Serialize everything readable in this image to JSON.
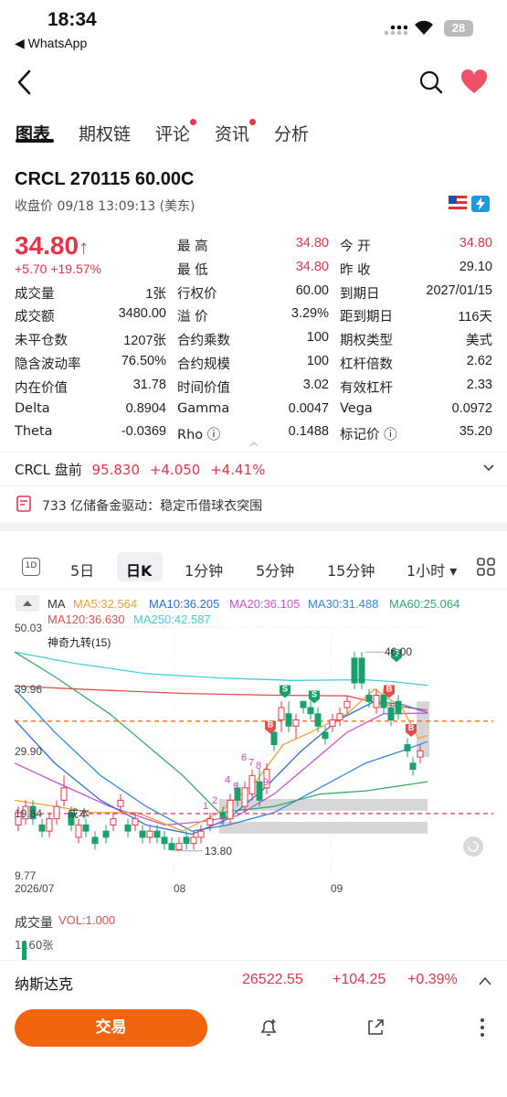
{
  "status_bar": {
    "time": "18:34",
    "back_app": "◀ WhatsApp",
    "battery": "28"
  },
  "tabs": [
    {
      "label": "图表",
      "active": true,
      "dot": false
    },
    {
      "label": "期权链",
      "active": false,
      "dot": false
    },
    {
      "label": "评论",
      "active": false,
      "dot": true
    },
    {
      "label": "资讯",
      "active": false,
      "dot": true
    },
    {
      "label": "分析",
      "active": false,
      "dot": false
    }
  ],
  "header": {
    "symbol": "CRCL 270115 60.00C",
    "close_info": "收盘价 09/18 13:09:13 (美东)",
    "price": "34.80",
    "price_arrow": "↑",
    "change": "+5.70  +19.57%"
  },
  "quote": {
    "rows": [
      [
        {
          "l": "最 高",
          "v": "34.80",
          "red": true
        },
        {
          "l": "今 开",
          "v": "34.80",
          "red": true
        }
      ],
      [
        {
          "l": "最 低",
          "v": "34.80",
          "red": true
        },
        {
          "l": "昨 收",
          "v": "29.10",
          "red": false
        }
      ],
      [
        {
          "l": "成交量",
          "v": "1张"
        },
        {
          "l": "行权价",
          "v": "60.00"
        },
        {
          "l": "到期日",
          "v": "2027/01/15"
        }
      ],
      [
        {
          "l": "成交额",
          "v": "3480.00"
        },
        {
          "l": "溢 价",
          "v": "3.29%"
        },
        {
          "l": "距到期日",
          "v": "116天"
        }
      ],
      [
        {
          "l": "未平仓数",
          "v": "1207张"
        },
        {
          "l": "合约乘数",
          "v": "100"
        },
        {
          "l": "期权类型",
          "v": "美式"
        }
      ],
      [
        {
          "l": "隐含波动率",
          "v": "76.50%"
        },
        {
          "l": "合约规模",
          "v": "100"
        },
        {
          "l": "杠杆倍数",
          "v": "2.62"
        }
      ],
      [
        {
          "l": "内在价值",
          "v": "31.78"
        },
        {
          "l": "时间价值",
          "v": "3.02"
        },
        {
          "l": "有效杠杆",
          "v": "2.33"
        }
      ],
      [
        {
          "l": "Delta",
          "v": "0.8904"
        },
        {
          "l": "Gamma",
          "v": "0.0047"
        },
        {
          "l": "Vega",
          "v": "0.0972"
        }
      ],
      [
        {
          "l": "Theta",
          "v": "-0.0369"
        },
        {
          "l": "Rho ⓘ",
          "v": "0.1488"
        },
        {
          "l": "标记价 ⓘ",
          "v": "35.20"
        }
      ]
    ]
  },
  "premarket": {
    "label": "CRCL 盘前",
    "price": "95.830",
    "change": "+4.050",
    "pct": "+4.41%"
  },
  "news": {
    "text": "733 亿储备金驱动：稳定币借球衣突围"
  },
  "chart_tabs": [
    "1D",
    "5日",
    "日K",
    "1分钟",
    "5分钟",
    "15分钟",
    "1小时 ▾"
  ],
  "ma_legend": {
    "ma": "MA",
    "items": [
      {
        "text": "MA5:32.564",
        "color": "#f0a030"
      },
      {
        "text": "MA10:36.205",
        "color": "#2f6fd8"
      },
      {
        "text": "MA20:36.105",
        "color": "#cc55cc"
      },
      {
        "text": "MA30:31.488",
        "color": "#3388dd"
      },
      {
        "text": "MA60:25.064",
        "color": "#33aa66"
      },
      {
        "text": "MA120:36.630",
        "color": "#e05050"
      },
      {
        "text": "MA250:42.587",
        "color": "#44ccdd"
      }
    ]
  },
  "chart_labels": {
    "indicator": "神奇九转(15)",
    "y_top": "50.03",
    "y_mid1": "39.96",
    "y_mid2": "29.90",
    "y_mid3": "19.84",
    "y_bottom": "9.77",
    "cost": "成本",
    "high_label": "46.00",
    "low_label": "13.80",
    "x_labels": [
      "2026/07",
      "08",
      "09"
    ]
  },
  "volume": {
    "title": "成交量",
    "vol": "VOL:1.000",
    "axis": "1160张"
  },
  "index_bar": {
    "name": "纳斯达克",
    "value": "26522.55",
    "change": "+104.25",
    "pct": "+0.39%"
  },
  "actions": {
    "trade": "交易"
  },
  "colors": {
    "up": "#e8334a",
    "down": "#1aa06b",
    "accent": "#f2650f"
  },
  "chart_data": {
    "type": "candlestick",
    "ylim": [
      9.77,
      50.03
    ],
    "x": [
      "2026/07",
      "08",
      "09"
    ],
    "annotations": {
      "high": 46.0,
      "low": 13.8,
      "cost_line": 19.84,
      "last_line": 34.8
    }
  }
}
